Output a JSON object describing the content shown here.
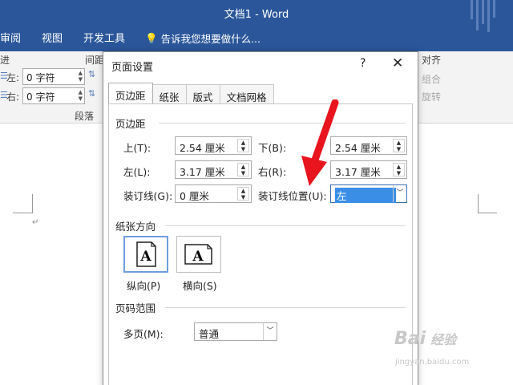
{
  "window": {
    "title": "文档1 - Word"
  },
  "ribbon_tabs": [
    "审阅",
    "视图",
    "开发工具"
  ],
  "tell_me": "告诉我您想要做什么...",
  "ribbon": {
    "indent_label": "进",
    "spacing_label": "间距",
    "left_label": "左:",
    "right_label": "右:",
    "left_value": "0 字符",
    "right_value": "0 字符",
    "group_label": "段落",
    "align": "对齐",
    "group": "组合",
    "rotate": "旋转"
  },
  "dialog": {
    "title": "页面设置",
    "help": "?",
    "close": "✕",
    "tabs": [
      "页边距",
      "纸张",
      "版式",
      "文档网格"
    ],
    "margins": {
      "section": "页边距",
      "top_label": "上(T):",
      "top_value": "2.54 厘米",
      "bottom_label": "下(B):",
      "bottom_value": "2.54 厘米",
      "left_label": "左(L):",
      "left_value": "3.17 厘米",
      "right_label": "右(R):",
      "right_value": "3.17 厘米",
      "gutter_label": "装订线(G):",
      "gutter_value": "0 厘米",
      "gutter_pos_label": "装订线位置(U):",
      "gutter_pos_value": "左"
    },
    "orientation": {
      "section": "纸张方向",
      "portrait": "纵向(P)",
      "landscape": "横向(S)",
      "glyph": "A"
    },
    "pages": {
      "section": "页码范围",
      "multi_label": "多页(M):",
      "multi_value": "普通"
    }
  },
  "watermark": {
    "brand": "Bai",
    "sub": "jingyan.baidu.com",
    "cn": "经验"
  },
  "colors": {
    "titlebar": "#2b579a",
    "arrow": "#e8141e",
    "highlight": "#3a8ee6"
  }
}
